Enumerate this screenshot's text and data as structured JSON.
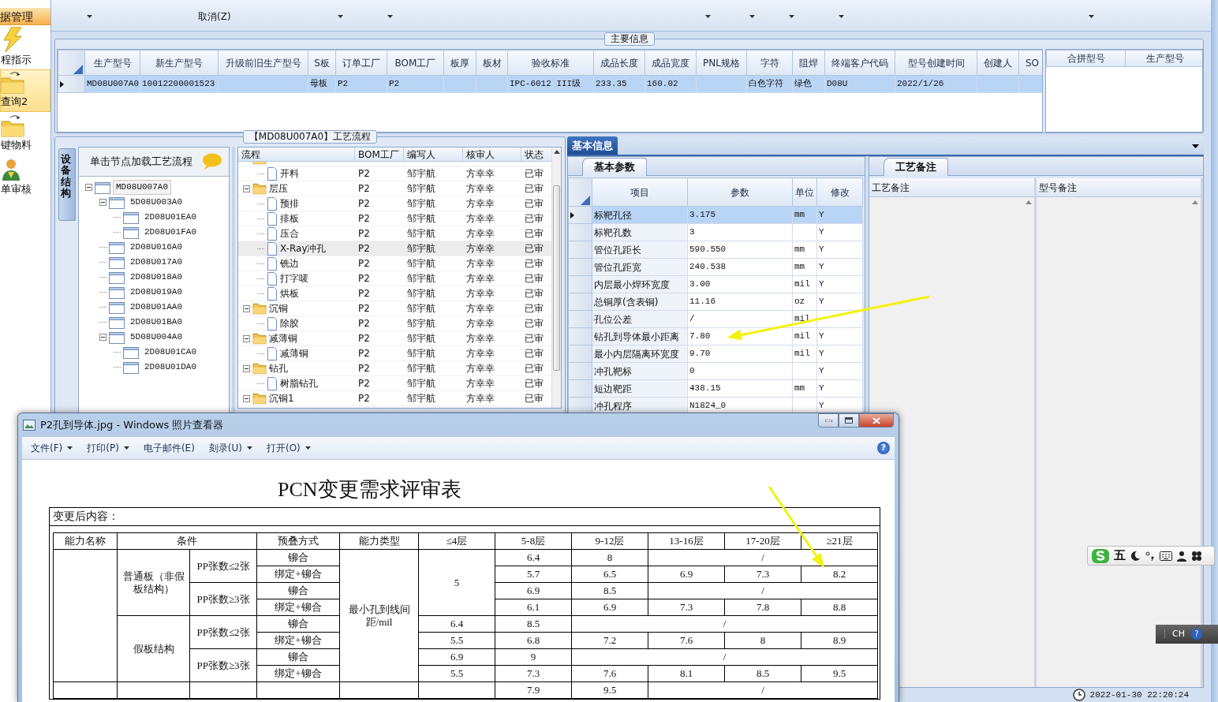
{
  "sidebar": {
    "header": "据管理",
    "items": [
      {
        "label": "程指示",
        "kind": "bolt",
        "selected": false
      },
      {
        "label": "查询2",
        "kind": "folder",
        "selected": true
      },
      {
        "label": "键物料",
        "kind": "folder",
        "selected": false
      },
      {
        "label": "单审核",
        "kind": "person",
        "selected": false
      }
    ]
  },
  "toolbar": {
    "cancel_label": "取消(Z)"
  },
  "main_info": {
    "title": "主要信息",
    "columns": [
      "生产型号",
      "新生产型号",
      "升级前旧生产型号",
      "S板",
      "订单工厂",
      "BOM工厂",
      "板厚",
      "板材",
      "验收标准",
      "成品长度",
      "成品宽度",
      "PNL规格",
      "字符",
      "阻焊",
      "终端客户代码",
      "型号创建时间",
      "创建人",
      "SO"
    ],
    "rows": [
      {
        "selected": true,
        "cells": [
          "MD08U007A0",
          "10012200001523",
          null,
          "母板",
          "P2",
          "P2",
          null,
          null,
          "IPC-6012 III级",
          "233.35",
          "160.02",
          null,
          "白色字符",
          "绿色",
          "D08U",
          "2022/1/26",
          null,
          null
        ]
      }
    ],
    "side_columns": [
      "合拼型号",
      "生产型号"
    ]
  },
  "process": {
    "title": "【MD08U007A0】工艺流程",
    "side_tab": "设备结构",
    "hint": "单击节点加载工艺流程",
    "tree": [
      {
        "label": "MD08U007A0",
        "expanded": true,
        "selected": true,
        "children": [
          {
            "label": "5D08U003A0",
            "expanded": true,
            "selected": false,
            "children": [
              {
                "label": "2D08U01EA0",
                "selected": false
              },
              {
                "label": "2D08U01FA0",
                "selected": false
              }
            ]
          },
          {
            "label": "2D08U016A0",
            "selected": false
          },
          {
            "label": "2D08U017A0",
            "selected": false
          },
          {
            "label": "2D08U018A0",
            "selected": false
          },
          {
            "label": "2D08U019A0",
            "selected": false
          },
          {
            "label": "2D08U01AA0",
            "selected": false
          },
          {
            "label": "2D08U01BA0",
            "selected": false
          },
          {
            "label": "5D08U004A0",
            "expanded": true,
            "selected": false,
            "children": [
              {
                "label": "2D08U01CA0",
                "selected": false
              },
              {
                "label": "2D08U01DA0",
                "selected": false
              }
            ]
          }
        ]
      }
    ],
    "columns": [
      "流程",
      "BOM工厂",
      "编写人",
      "核审人",
      "状态"
    ],
    "rows": [
      {
        "kind": "folder",
        "selected": false,
        "children": [
          {
            "kind": "file",
            "label": "开料",
            "selected": false,
            "cells": [
              "P2",
              "邹宇航",
              "方幸幸",
              "已审"
            ]
          }
        ]
      },
      {
        "kind": "folder",
        "label": "层压",
        "expanded": true,
        "selected": false,
        "cells": [
          "P2",
          "邹宇航",
          "方幸幸",
          "已审"
        ],
        "children": [
          {
            "kind": "file",
            "label": "预排",
            "selected": false,
            "cells": [
              "P2",
              "邹宇航",
              "方幸幸",
              "已审"
            ]
          },
          {
            "kind": "file",
            "label": "排板",
            "selected": false,
            "cells": [
              "P2",
              "邹宇航",
              "方幸幸",
              "已审"
            ]
          },
          {
            "kind": "file",
            "label": "压合",
            "selected": false,
            "cells": [
              "P2",
              "邹宇航",
              "方幸幸",
              "已审"
            ]
          },
          {
            "kind": "file",
            "label": "X-Ray冲孔",
            "selected": true,
            "cells": [
              "P2",
              "邹宇航",
              "方幸幸",
              "已审"
            ]
          },
          {
            "kind": "file",
            "label": "铣边",
            "selected": false,
            "cells": [
              "P2",
              "邹宇航",
              "方幸幸",
              "已审"
            ]
          },
          {
            "kind": "file",
            "label": "打字唛",
            "selected": false,
            "cells": [
              "P2",
              "邹宇航",
              "方幸幸",
              "已审"
            ]
          },
          {
            "kind": "file",
            "label": "烘板",
            "selected": false,
            "cells": [
              "P2",
              "邹宇航",
              "方幸幸",
              "已审"
            ]
          }
        ]
      },
      {
        "kind": "folder",
        "label": "沉铜",
        "expanded": true,
        "selected": false,
        "cells": [
          "P2",
          "邹宇航",
          "方幸幸",
          "已审"
        ],
        "children": [
          {
            "kind": "file",
            "label": "除胶",
            "selected": false,
            "cells": [
              "P2",
              "邹宇航",
              "方幸幸",
              "已审"
            ]
          }
        ]
      },
      {
        "kind": "folder",
        "label": "减薄铜",
        "expanded": true,
        "selected": false,
        "cells": [
          "P2",
          "邹宇航",
          "方幸幸",
          "已审"
        ],
        "children": [
          {
            "kind": "file",
            "label": "减薄铜",
            "selected": false,
            "cells": [
              "P2",
              "邹宇航",
              "方幸幸",
              "已审"
            ]
          }
        ]
      },
      {
        "kind": "folder",
        "label": "钻孔",
        "expanded": true,
        "selected": false,
        "cells": [
          "P2",
          "邹宇航",
          "方幸幸",
          "已审"
        ],
        "children": [
          {
            "kind": "file",
            "label": "树脂钻孔",
            "selected": false,
            "cells": [
              "P2",
              "邹宇航",
              "方幸幸",
              "已审"
            ]
          }
        ]
      },
      {
        "kind": "folder",
        "label": "沉铜1",
        "expanded": true,
        "selected": false,
        "cells": [
          "P2",
          "邹宇航",
          "方幸幸",
          "已审"
        ]
      }
    ]
  },
  "basic_info": {
    "tab": "基本信息",
    "params_tab": "基本参数",
    "columns": [
      "项目",
      "参数",
      "单位",
      "修改"
    ],
    "rows": [
      {
        "item": "标靶孔径",
        "value": "3.175",
        "unit": "mm",
        "modify": "Y",
        "selected": true
      },
      {
        "item": "标靶孔数",
        "value": "3",
        "modify": "Y",
        "selected": false
      },
      {
        "item": "管位孔距长",
        "value": "590.550",
        "unit": "mm",
        "modify": "Y",
        "selected": false
      },
      {
        "item": "管位孔距宽",
        "value": "240.538",
        "unit": "mm",
        "modify": "Y",
        "selected": false
      },
      {
        "item": "内层最小焊环宽度",
        "value": "3.00",
        "unit": "mil",
        "modify": "Y",
        "selected": false
      },
      {
        "item": "总铜厚(含表铜)",
        "value": "11.16",
        "unit": "oz",
        "modify": "Y",
        "selected": false
      },
      {
        "item": "孔位公差",
        "value": "/",
        "unit": "mil",
        "selected": false
      },
      {
        "item": "钻孔到导体最小距离",
        "value": "7.80",
        "unit": "mil",
        "modify": "Y",
        "selected": false
      },
      {
        "item": "最小内层隔离环宽度",
        "value": "9.70",
        "unit": "mil",
        "modify": "Y",
        "selected": false
      },
      {
        "item": "冲孔靶标",
        "value": "0",
        "modify": "Y",
        "selected": false
      },
      {
        "item": "短边靶距",
        "value": "438.15",
        "unit": "mm",
        "modify": "Y",
        "selected": false
      },
      {
        "item": "冲孔程序",
        "value": "N1824_0",
        "modify": "Y",
        "selected": false
      }
    ],
    "notes_tab": "工艺备注",
    "notes_columns": [
      "工艺备注",
      "型号备注"
    ]
  },
  "viewer": {
    "title": "P2孔到导体.jpg - Windows 照片查看器",
    "help": "?",
    "menu": [
      {
        "label": "文件(F)",
        "dropdown": true
      },
      {
        "label": "打印(P)",
        "dropdown": true
      },
      {
        "label": "电子邮件(E)",
        "dropdown": false
      },
      {
        "label": "刻录(U)",
        "dropdown": true
      },
      {
        "label": "打开(O)",
        "dropdown": true
      }
    ],
    "document": {
      "title": "PCN变更需求评审表",
      "section": "变更后内容：",
      "header": [
        {
          "text": "能力名称"
        },
        {
          "text": "条件",
          "colspan": 2
        },
        {
          "text": "预叠方式"
        },
        {
          "text": "能力类型"
        },
        {
          "text": "≤4层"
        },
        {
          "text": "5-8层"
        },
        {
          "text": "9-12层"
        },
        {
          "text": "13-16层"
        },
        {
          "text": "17-20层"
        },
        {
          "text": "≥21层"
        }
      ],
      "rows": [
        [
          {
            "rowspan": 8
          },
          {
            "text": "普通板（非假板结构）",
            "rowspan": 4
          },
          {
            "text": "PP张数≤2张",
            "rowspan": 2
          },
          {
            "text": "铆合"
          },
          {
            "text": "最小孔到线间距/mil",
            "rowspan": 8
          },
          {
            "text": "5",
            "rowspan": 4
          },
          {
            "text": "6.4"
          },
          {
            "text": "8"
          },
          {
            "text": "/",
            "colspan": 3
          }
        ],
        [
          {
            "text": "绑定+铆合"
          },
          {
            "text": "5.7"
          },
          {
            "text": "6.5"
          },
          {
            "text": "6.9"
          },
          {
            "text": "7.3"
          },
          {
            "text": "8.2"
          }
        ],
        [
          {
            "text": "PP张数≥3张",
            "rowspan": 2
          },
          {
            "text": "铆合"
          },
          {
            "text": "6.9"
          },
          {
            "text": "8.5"
          },
          {
            "text": "/",
            "colspan": 3
          }
        ],
        [
          {
            "text": "绑定+铆合"
          },
          {
            "text": "6.1"
          },
          {
            "text": "6.9"
          },
          {
            "text": "7.3"
          },
          {
            "text": "7.8"
          },
          {
            "text": "8.8"
          }
        ],
        [
          {
            "text": "假板结构",
            "rowspan": 4
          },
          {
            "text": "PP张数≤2张",
            "rowspan": 2
          },
          {
            "text": "铆合"
          },
          {
            "text": "6.4"
          },
          {
            "text": "8.5"
          },
          {
            "text": "/",
            "colspan": 4
          }
        ],
        [
          {
            "text": "绑定+铆合"
          },
          {
            "text": "5.5"
          },
          {
            "text": "6.8"
          },
          {
            "text": "7.2"
          },
          {
            "text": "7.6"
          },
          {
            "text": "8"
          },
          {
            "text": "8.9"
          }
        ],
        [
          {
            "text": "PP张数≥3张",
            "rowspan": 2
          },
          {
            "text": "铆合"
          },
          {
            "text": "6.9"
          },
          {
            "text": "9"
          },
          {
            "text": "/",
            "colspan": 4
          }
        ],
        [
          {
            "text": "绑定+铆合"
          },
          {
            "text": "5.5"
          },
          {
            "text": "7.3"
          },
          {
            "text": "7.6"
          },
          {
            "text": "8.1"
          },
          {
            "text": "8.5"
          },
          {
            "text": "9.5"
          }
        ],
        [
          {},
          {},
          {},
          {},
          {},
          {},
          {
            "text": "7.9"
          },
          {
            "text": "9.5"
          },
          {
            "text": "/",
            "colspan": 3
          }
        ]
      ]
    }
  },
  "ime": {
    "label": "五"
  },
  "language_bar": {
    "label": "CH",
    "help": "?"
  },
  "status_bar": {
    "clock": "2022-01-30 22:20:24"
  }
}
